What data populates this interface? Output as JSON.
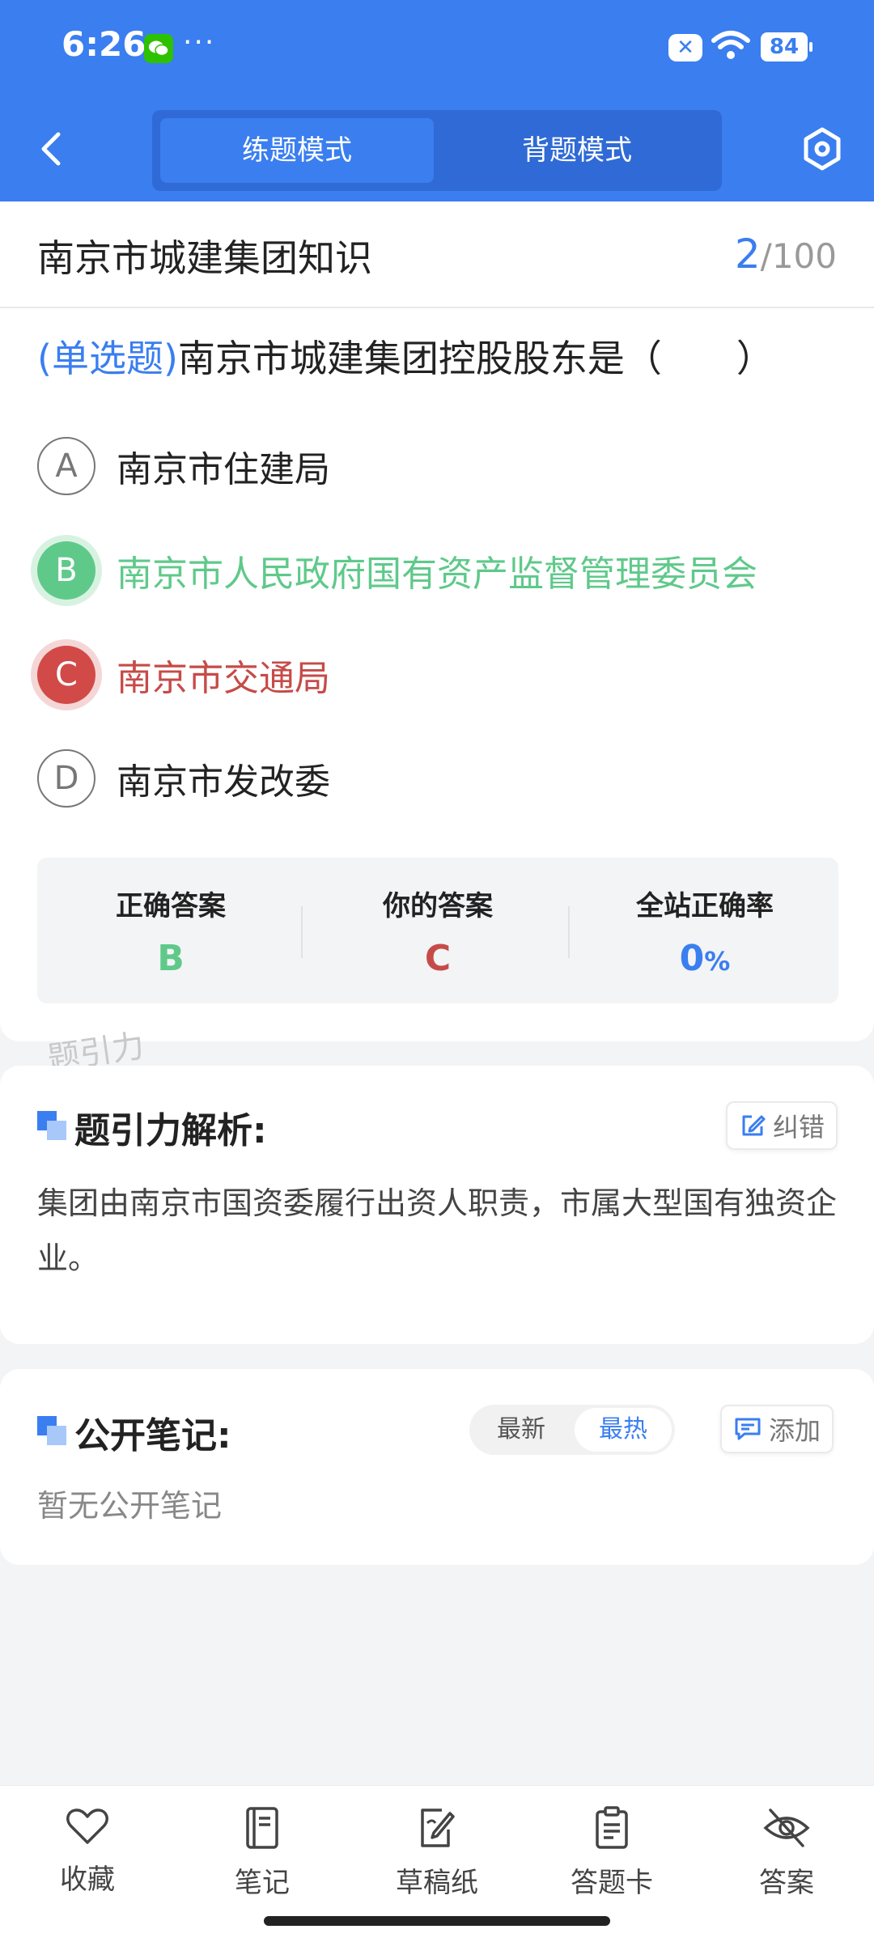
{
  "status_bar": {
    "time": "6:26",
    "dots": "···",
    "battery": "84"
  },
  "header": {
    "modes": [
      "练题模式",
      "背题模式"
    ]
  },
  "topic": {
    "title": "南京市城建集团知识",
    "current": "2",
    "total": "/100"
  },
  "question": {
    "type": "(单选题)",
    "text": "南京市城建集团控股股东是（　　）",
    "options": [
      {
        "letter": "A",
        "text": "南京市住建局",
        "state": "normal"
      },
      {
        "letter": "B",
        "text": "南京市人民政府国有资产监督管理委员会",
        "state": "correct"
      },
      {
        "letter": "C",
        "text": "南京市交通局",
        "state": "wrong"
      },
      {
        "letter": "D",
        "text": "南京市发改委",
        "state": "normal"
      }
    ]
  },
  "stats": {
    "correct_label": "正确答案",
    "correct_value": "B",
    "yours_label": "你的答案",
    "yours_value": "C",
    "rate_label": "全站正确率",
    "rate_value": "0",
    "rate_unit": "%"
  },
  "watermark": "题引力",
  "analysis": {
    "title": "题引力解析:",
    "report_label": "纠错",
    "text": "集团由南京市国资委履行出资人职责，市属大型国有独资企业。"
  },
  "notes": {
    "title": "公开笔记:",
    "sort_options": [
      "最新",
      "最热"
    ],
    "add_label": "添加",
    "empty_text": "暂无公开笔记"
  },
  "bottom_nav": [
    {
      "label": "收藏",
      "icon": "heart-icon"
    },
    {
      "label": "笔记",
      "icon": "notebook-icon"
    },
    {
      "label": "草稿纸",
      "icon": "draft-paper-icon"
    },
    {
      "label": "答题卡",
      "icon": "answer-sheet-icon"
    },
    {
      "label": "答案",
      "icon": "eye-off-icon"
    }
  ],
  "colors": {
    "primary": "#3a7ef0",
    "correct": "#5fc98a",
    "wrong": "#d14a48"
  }
}
